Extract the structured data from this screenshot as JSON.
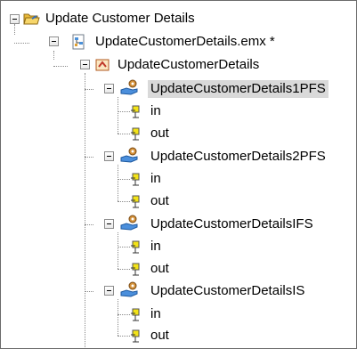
{
  "tree": {
    "project": {
      "label": "Update Customer Details",
      "icon": "folder-icon"
    },
    "model": {
      "label": "UpdateCustomerDetails.emx *",
      "icon": "uml-model-icon"
    },
    "package": {
      "label": "UpdateCustomerDetails",
      "icon": "package-icon"
    },
    "components": [
      {
        "label": "UpdateCustomerDetails1PFS",
        "icon": "component-icon",
        "selected": true,
        "ports": [
          {
            "label": "in",
            "icon": "port-icon"
          },
          {
            "label": "out",
            "icon": "port-icon"
          }
        ]
      },
      {
        "label": "UpdateCustomerDetails2PFS",
        "icon": "component-icon",
        "selected": false,
        "ports": [
          {
            "label": "in",
            "icon": "port-icon"
          },
          {
            "label": "out",
            "icon": "port-icon"
          }
        ]
      },
      {
        "label": "UpdateCustomerDetailsIFS",
        "icon": "component-icon",
        "selected": false,
        "ports": [
          {
            "label": "in",
            "icon": "port-icon"
          },
          {
            "label": "out",
            "icon": "port-icon"
          }
        ]
      },
      {
        "label": "UpdateCustomerDetailsIS",
        "icon": "component-icon",
        "selected": false,
        "ports": [
          {
            "label": "in",
            "icon": "port-icon"
          },
          {
            "label": "out",
            "icon": "port-icon"
          }
        ]
      }
    ]
  },
  "colors": {
    "selection": "#d9d9d9",
    "folder": "#f2c94c",
    "port": "#e6d400",
    "component_hand": "#3a7fd0",
    "component_gear": "#c8832a"
  }
}
